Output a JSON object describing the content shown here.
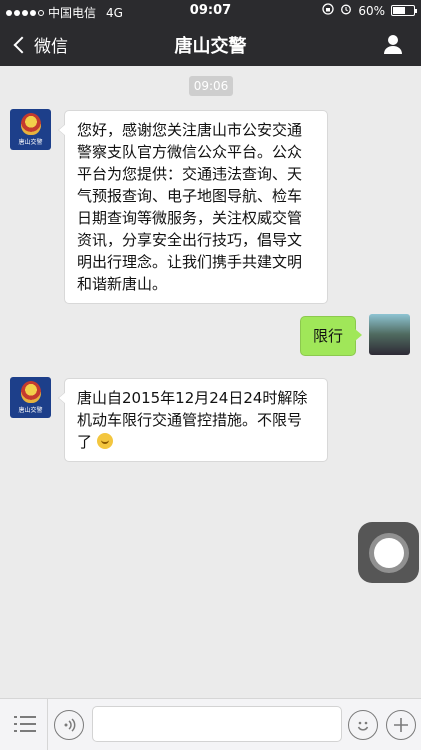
{
  "status_bar": {
    "carrier": "中国电信",
    "network": "4G",
    "time": "09:07",
    "battery": "60%",
    "battery_level": 0.6
  },
  "nav": {
    "back_label": "微信",
    "title": "唐山交警"
  },
  "chat": {
    "timestamp": "09:06",
    "police_avatar_label": "唐山交警",
    "messages": [
      {
        "from": "唐山交警",
        "text": "您好，感谢您关注唐山市公安交通警察支队官方微信公众平台。公众平台为您提供：交通违法查询、天气预报查询、电子地图导航、检车日期查询等微服务，关注权威交管资讯，分享安全出行技巧，倡导文明出行理念。让我们携手共建文明和谐新唐山。"
      },
      {
        "from": "me",
        "text": "限行"
      },
      {
        "from": "唐山交警",
        "text": "唐山自2015年12月24日24时解除机动车限行交通管控措施。不限号了"
      }
    ]
  },
  "input": {
    "value": "",
    "placeholder": ""
  },
  "colors": {
    "nav_bg": "#2b2b2e",
    "chat_bg": "#ebebeb",
    "outgoing_bubble": "#a0e759",
    "incoming_bubble": "#ffffff"
  }
}
